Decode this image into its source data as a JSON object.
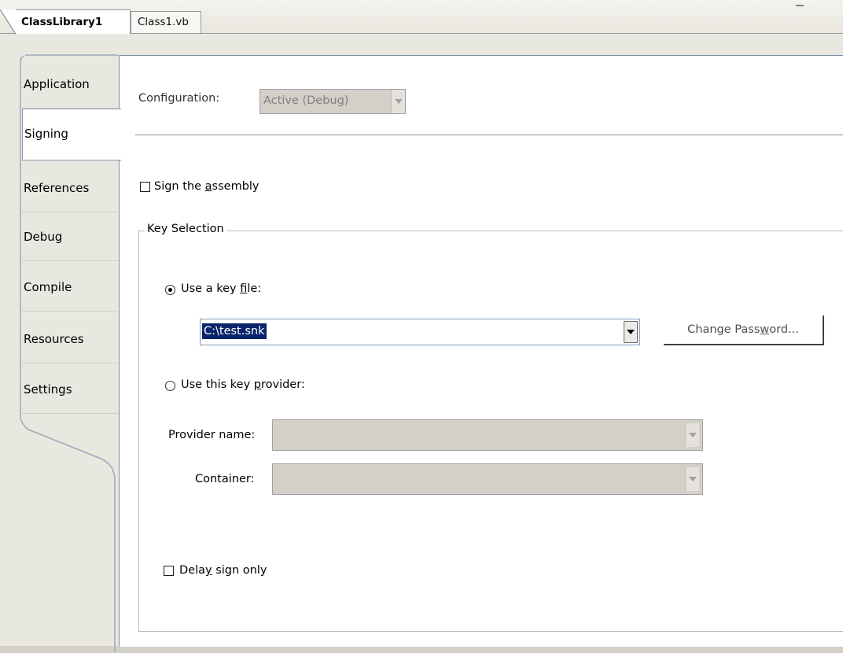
{
  "tabs": {
    "active": "ClassLibrary1",
    "other": "Class1.vb"
  },
  "sidebar": {
    "items": [
      {
        "label": "Application"
      },
      {
        "label": "Signing"
      },
      {
        "label": "References"
      },
      {
        "label": "Debug"
      },
      {
        "label": "Compile"
      },
      {
        "label": "Resources"
      },
      {
        "label": "Settings"
      }
    ],
    "selected": "Signing"
  },
  "config": {
    "label": "Configuration:",
    "value": "Active (Debug)"
  },
  "sign_assembly": {
    "pre": "Sign the ",
    "access": "a",
    "post": "ssembly",
    "checked": false
  },
  "key_selection": {
    "legend": "Key Selection",
    "use_key_file": {
      "pre": "Use a key ",
      "access": "f",
      "post": "ile:",
      "selected": true
    },
    "key_file_value": "C:\\test.snk",
    "change_password": {
      "pre": "Change Pass",
      "access": "w",
      "post": "ord..."
    },
    "use_provider": {
      "pre": "Use this key ",
      "access": "p",
      "post": "rovider:",
      "selected": false
    },
    "provider_name_label": "Provider name:",
    "container_label": "Container:"
  },
  "delay_sign": {
    "pre": "Dela",
    "access": "y",
    "post": " sign only",
    "checked": false
  }
}
